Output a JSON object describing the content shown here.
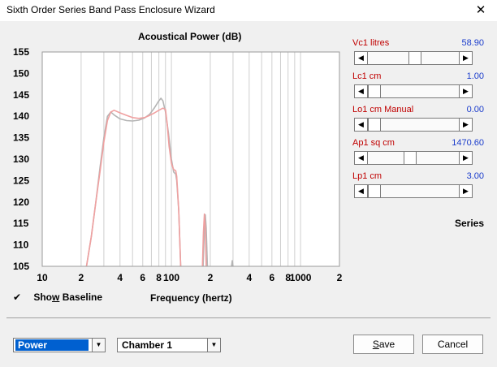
{
  "window": {
    "title": "Sixth Order Series Band Pass Enclosure Wizard",
    "close_glyph": "✕"
  },
  "plot": {
    "title": "Acoustical Power (dB)",
    "xlabel": "Frequency (hertz)"
  },
  "params": [
    {
      "name": "Vc1  litres",
      "value": "58.90",
      "position": 0.52
    },
    {
      "name": "Lc1  cm",
      "value": "1.00",
      "position": 0.0
    },
    {
      "name": "Lo1  cm  Manual",
      "value": "0.00",
      "position": 0.0
    },
    {
      "name": "Ap1  sq cm",
      "value": "1470.60",
      "position": 0.46
    },
    {
      "name": "Lp1  cm",
      "value": "3.00",
      "position": 0.0
    }
  ],
  "series_label": "Series",
  "show_baseline": {
    "check": "✔",
    "pre": "Sho",
    "accel": "w",
    "post": " Baseline",
    "checked": true
  },
  "combos": {
    "view": "Power",
    "chamber": "Chamber 1"
  },
  "buttons": {
    "save_accel": "S",
    "save_rest": "ave",
    "cancel": "Cancel"
  },
  "colors": {
    "baseline": "#b4b4b4",
    "current": "#f0a0a0",
    "label_red": "#c00000",
    "value_blue": "#1a3ccc"
  },
  "chart_data": {
    "type": "line",
    "xscale": "log",
    "xlim": [
      10,
      2000
    ],
    "ylim": [
      105,
      155
    ],
    "yticks": [
      105,
      110,
      115,
      120,
      125,
      130,
      135,
      140,
      145,
      150,
      155
    ],
    "xtick_labels": [
      {
        "x": 10,
        "label": "10"
      },
      {
        "x": 20,
        "label": "2"
      },
      {
        "x": 40,
        "label": "4"
      },
      {
        "x": 60,
        "label": "6"
      },
      {
        "x": 80,
        "label": "8"
      },
      {
        "x": 100,
        "label": "100"
      },
      {
        "x": 200,
        "label": "2"
      },
      {
        "x": 400,
        "label": "4"
      },
      {
        "x": 600,
        "label": "6"
      },
      {
        "x": 800,
        "label": "8"
      },
      {
        "x": 1000,
        "label": "1000"
      },
      {
        "x": 2000,
        "label": "2"
      }
    ],
    "series": [
      {
        "role": "baseline",
        "points": [
          [
            22,
            105
          ],
          [
            24,
            112
          ],
          [
            26,
            120
          ],
          [
            28,
            128
          ],
          [
            30,
            135
          ],
          [
            32,
            140
          ],
          [
            34,
            141
          ],
          [
            36,
            140.3
          ],
          [
            40,
            139.4
          ],
          [
            45,
            139
          ],
          [
            50,
            138.9
          ],
          [
            56,
            139.1
          ],
          [
            62,
            139.6
          ],
          [
            68,
            140.5
          ],
          [
            74,
            142
          ],
          [
            80,
            143.6
          ],
          [
            83,
            144.2
          ],
          [
            86,
            143.6
          ],
          [
            90,
            141
          ],
          [
            95,
            136
          ],
          [
            100,
            130
          ],
          [
            104,
            127
          ],
          [
            108,
            126.5
          ],
          [
            110,
            125
          ],
          [
            114,
            118
          ],
          [
            118,
            105
          ]
        ]
      },
      {
        "role": "baseline",
        "points": [
          [
            176,
            105
          ],
          [
            180,
            114
          ],
          [
            183,
            117
          ],
          [
            186,
            114
          ],
          [
            190,
            105
          ]
        ]
      },
      {
        "role": "baseline",
        "points": [
          [
            292,
            105
          ],
          [
            296,
            106.3
          ],
          [
            300,
            105
          ]
        ]
      },
      {
        "role": "current",
        "points": [
          [
            22,
            105
          ],
          [
            24,
            112
          ],
          [
            26,
            120
          ],
          [
            28,
            127
          ],
          [
            30,
            134
          ],
          [
            32,
            139
          ],
          [
            34,
            141
          ],
          [
            36,
            141.4
          ],
          [
            40,
            140.8
          ],
          [
            45,
            140.2
          ],
          [
            50,
            139.7
          ],
          [
            56,
            139.5
          ],
          [
            62,
            139.7
          ],
          [
            68,
            140.2
          ],
          [
            74,
            140.8
          ],
          [
            80,
            141.4
          ],
          [
            86,
            141.9
          ],
          [
            90,
            141.6
          ],
          [
            93,
            138
          ],
          [
            96,
            133
          ],
          [
            100,
            129
          ],
          [
            104,
            127.6
          ],
          [
            108,
            127.3
          ],
          [
            110,
            126
          ],
          [
            114,
            118
          ],
          [
            118,
            105
          ]
        ]
      },
      {
        "role": "current",
        "points": [
          [
            174,
            105
          ],
          [
            177,
            113
          ],
          [
            180,
            117.2
          ],
          [
            183,
            114
          ],
          [
            186,
            105
          ]
        ]
      }
    ]
  }
}
